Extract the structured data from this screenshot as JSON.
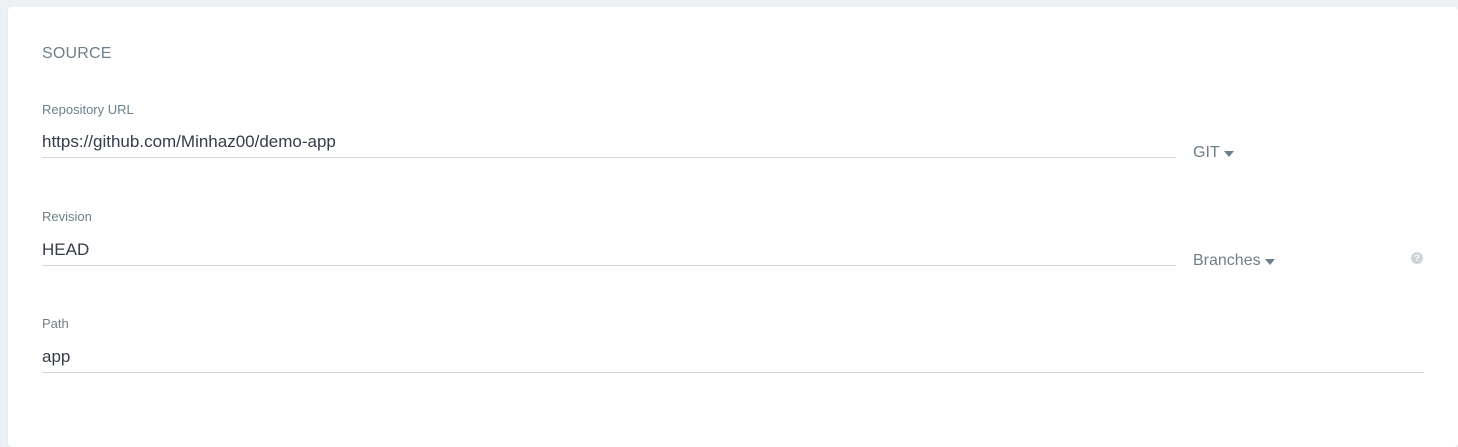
{
  "source": {
    "title": "SOURCE",
    "repository": {
      "label": "Repository URL",
      "value": "https://github.com/Minhaz00/demo-app",
      "type_dropdown": "GIT"
    },
    "revision": {
      "label": "Revision",
      "value": "HEAD",
      "type_dropdown": "Branches",
      "help_icon": "question-circle-icon"
    },
    "path": {
      "label": "Path",
      "value": "app"
    }
  }
}
